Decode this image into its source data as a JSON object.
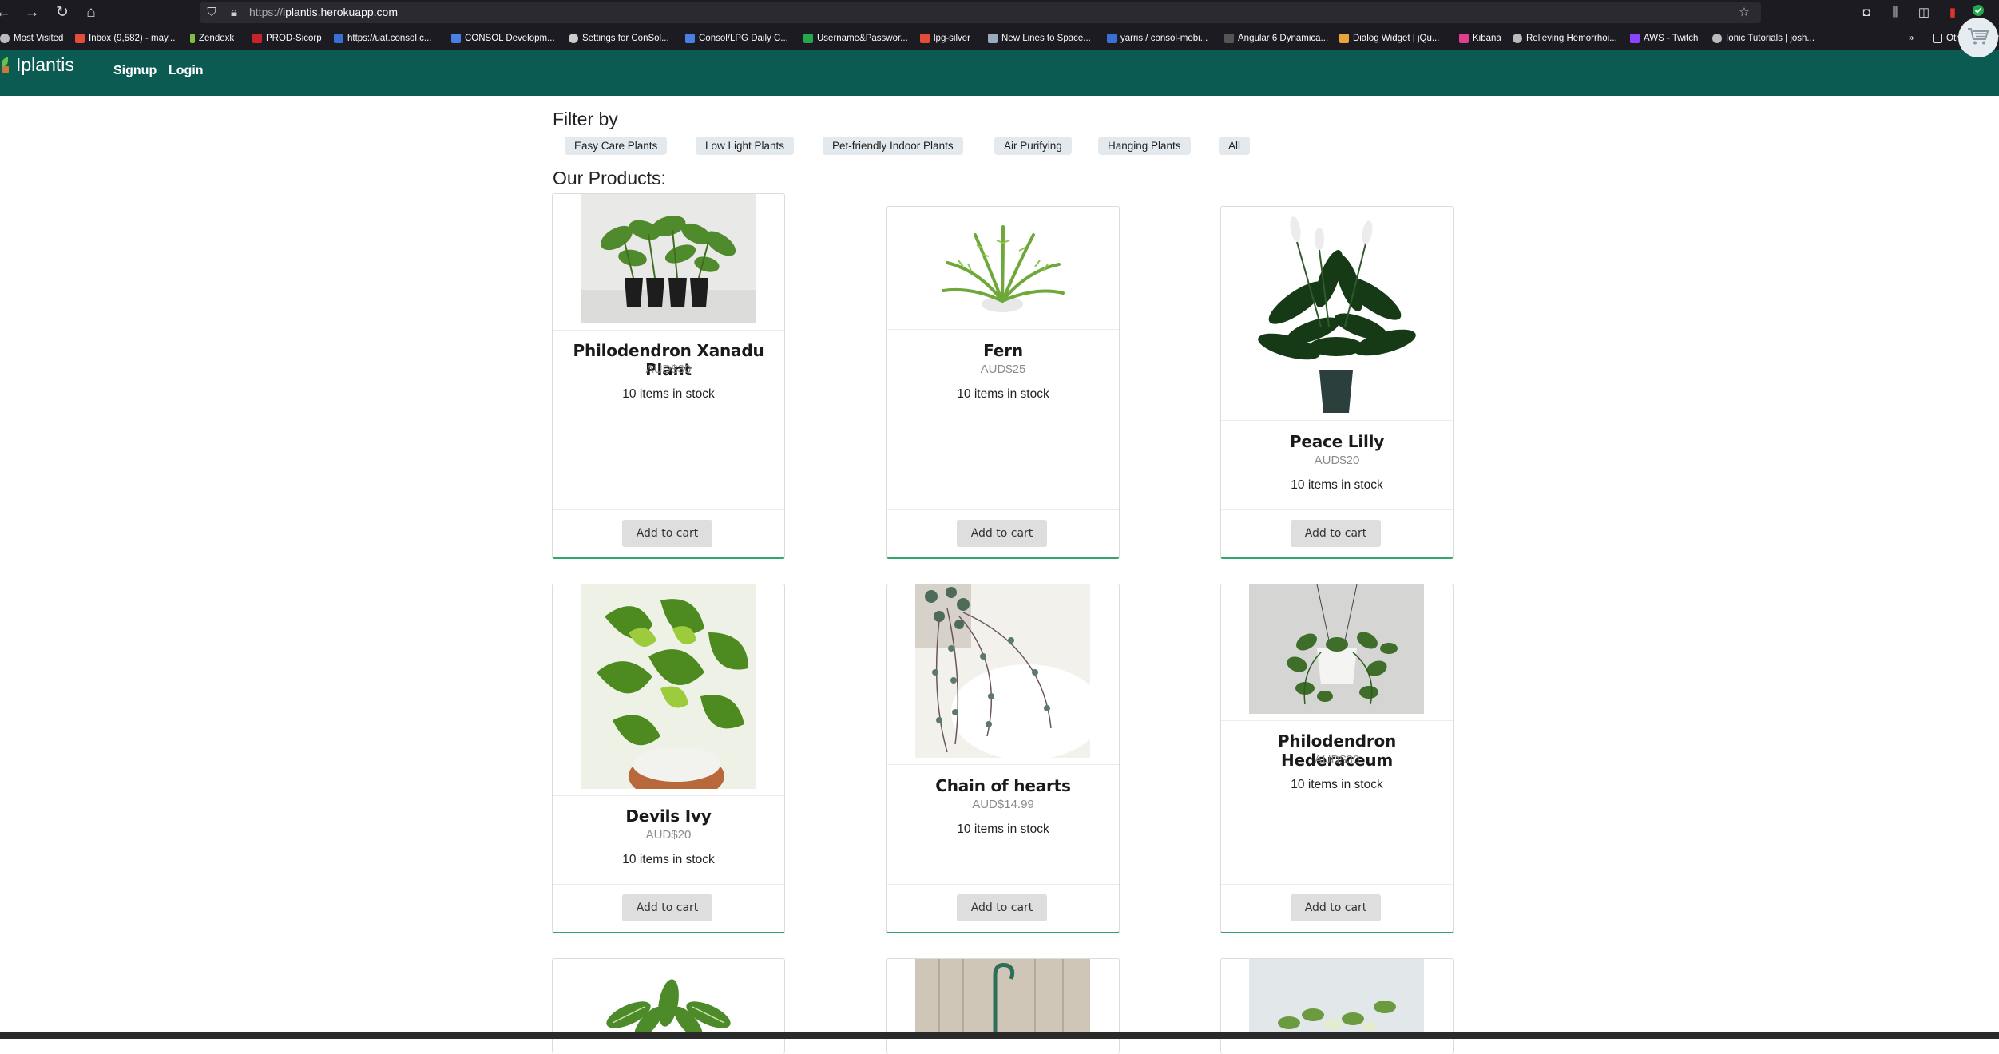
{
  "browser": {
    "url_scheme": "https://",
    "url_host": "iplantis.herokuapp.com",
    "bookmarks": [
      "Most Visited",
      "Inbox (9,582) - may...",
      "Zendexk",
      "PROD-Sicorp",
      "https://uat.consol.c...",
      "CONSOL Developm...",
      "Settings for ConSol...",
      "Consol/LPG Daily C...",
      "Username&Passwor...",
      "lpg-silver",
      "New Lines to Space...",
      "yarris / consol-mobi...",
      "Angular 6 Dynamica...",
      "Dialog Widget | jQu...",
      "Kibana",
      "Relieving Hemorrhoi...",
      "AWS - Twitch",
      "Ionic Tutorials | josh..."
    ],
    "other_bookmarks": "Other Bookm"
  },
  "header": {
    "brand": "Iplantis",
    "signup": "Signup",
    "login": "Login"
  },
  "filters": {
    "title": "Filter by",
    "options": [
      "Easy Care Plants",
      "Low Light Plants",
      "Pet-friendly Indoor Plants",
      "Air Purifying",
      "Hanging Plants",
      "All"
    ]
  },
  "products_title": "Our Products:",
  "products": [
    {
      "name": "Philodendron Xanadu Plant",
      "price": "AUD$30",
      "stock": "10 items in stock",
      "button": "Add to cart"
    },
    {
      "name": "Fern",
      "price": "AUD$25",
      "stock": "10 items in stock",
      "button": "Add to cart"
    },
    {
      "name": "Peace Lilly",
      "price": "AUD$20",
      "stock": "10 items in stock",
      "button": "Add to cart"
    },
    {
      "name": "Devils Ivy",
      "price": "AUD$20",
      "stock": "10 items in stock",
      "button": "Add to cart"
    },
    {
      "name": "Chain of hearts",
      "price": "AUD$14.99",
      "stock": "10 items in stock",
      "button": "Add to cart"
    },
    {
      "name": "Philodendron Hederaceum",
      "price": "AUD$30",
      "stock": "10 items in stock",
      "button": "Add to cart"
    }
  ],
  "colors": {
    "header_bg": "#0c5b53",
    "card_accent": "#33a56a",
    "chip_bg": "#e4e9ee"
  }
}
